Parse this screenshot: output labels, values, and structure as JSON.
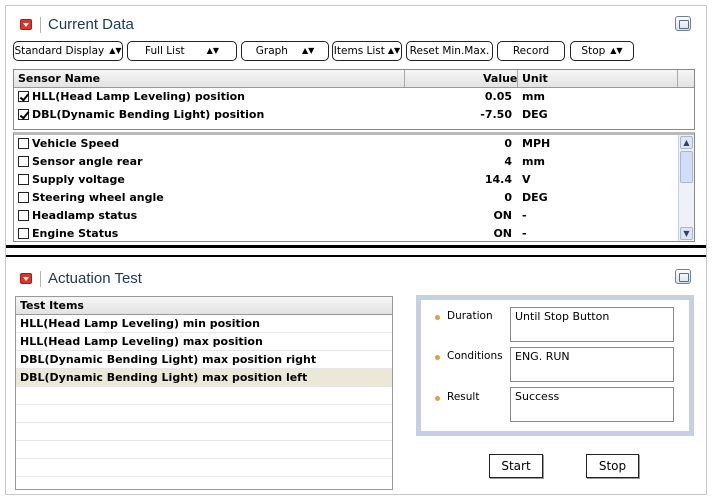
{
  "current_data": {
    "title": "Current Data",
    "toolbar": {
      "standard_display": "Standard Display",
      "full_list": "Full List",
      "graph": "Graph",
      "items_list": "Items List",
      "reset_min_max": "Reset Min.Max.",
      "record": "Record",
      "stop": "Stop"
    },
    "columns": {
      "name": "Sensor Name",
      "value": "Value",
      "unit": "Unit"
    },
    "pinned_rows": [
      {
        "name": "HLL(Head Lamp Leveling) position",
        "value": "0.05",
        "unit": "mm",
        "checked": true
      },
      {
        "name": "DBL(Dynamic Bending Light) position",
        "value": "-7.50",
        "unit": "DEG",
        "checked": true
      }
    ],
    "rows": [
      {
        "name": "Vehicle Speed",
        "value": "0",
        "unit": "MPH",
        "checked": false
      },
      {
        "name": "Sensor angle rear",
        "value": "4",
        "unit": "mm",
        "checked": false
      },
      {
        "name": "Supply voltage",
        "value": "14.4",
        "unit": "V",
        "checked": false
      },
      {
        "name": "Steering wheel angle",
        "value": "0",
        "unit": "DEG",
        "checked": false
      },
      {
        "name": "Headlamp status",
        "value": "ON",
        "unit": "-",
        "checked": false
      },
      {
        "name": "Engine Status",
        "value": "ON",
        "unit": "-",
        "checked": false
      }
    ]
  },
  "actuation_test": {
    "title": "Actuation Test",
    "list_header": "Test Items",
    "items": [
      "HLL(Head Lamp Leveling) min position",
      "HLL(Head Lamp Leveling) max position",
      "DBL(Dynamic Bending Light) max position right",
      "DBL(Dynamic Bending Light) max position left"
    ],
    "selected_index": 3,
    "info": {
      "duration_label": "Duration",
      "duration_value": "Until Stop Button",
      "conditions_label": "Conditions",
      "conditions_value": "ENG. RUN",
      "result_label": "Result",
      "result_value": "Success"
    },
    "start_label": "Start",
    "stop_label": "Stop"
  },
  "colors": {
    "accent_red": "#d9362a",
    "title_blue": "#203a5a",
    "selection": "#ebe8d8",
    "info_border": "#c7d0e3"
  },
  "scrollbar": {
    "up_icon": "scroll-up-arrow-icon",
    "down_icon": "scroll-down-arrow-icon"
  }
}
